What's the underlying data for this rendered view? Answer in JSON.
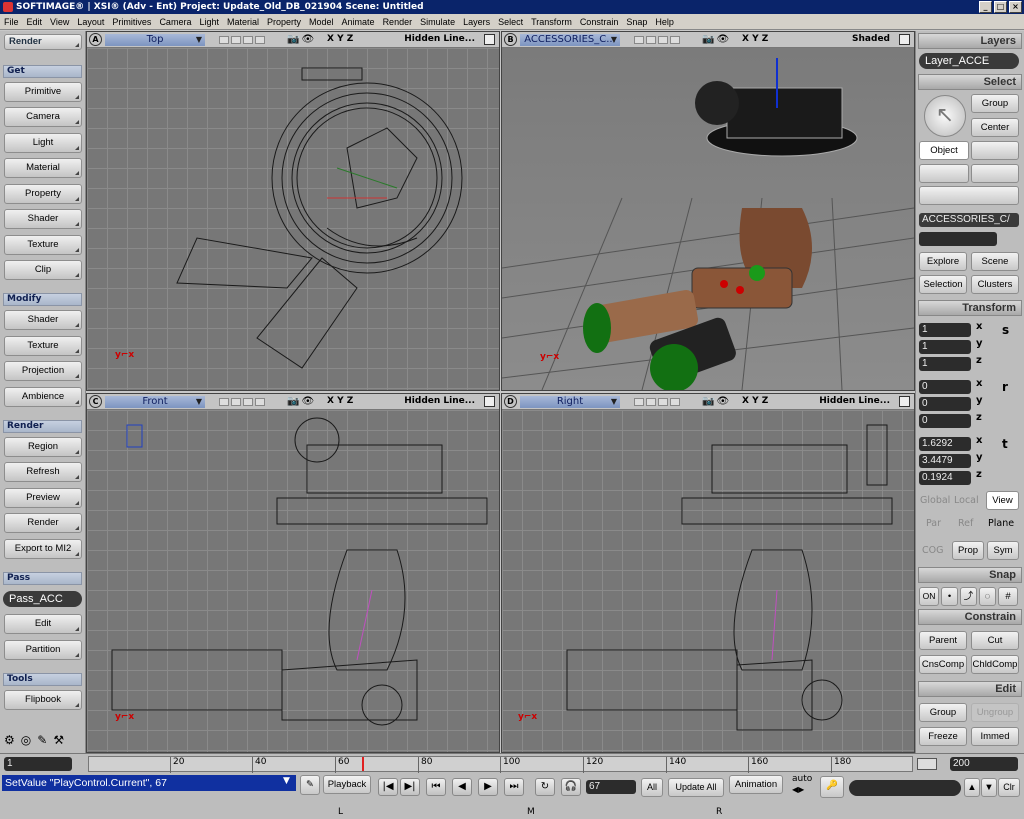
{
  "titlebar": {
    "title": "SOFTIMAGE® | XSI® (Adv - Ent) Project: Update_Old_DB_021904    Scene: Untitled",
    "min": "_",
    "max": "□",
    "close": "×"
  },
  "menu": [
    "File",
    "Edit",
    "View",
    "Layout",
    "Primitives",
    "Camera",
    "Light",
    "Material",
    "Property",
    "Model",
    "Animate",
    "Render",
    "Simulate",
    "Layers",
    "Select",
    "Transform",
    "Constrain",
    "Snap",
    "Help"
  ],
  "left": {
    "header": "Render",
    "get": {
      "title": "Get",
      "items": [
        "Primitive",
        "Camera",
        "Light",
        "Material",
        "Property",
        "Shader",
        "Texture",
        "Clip"
      ]
    },
    "modify": {
      "title": "Modify",
      "items": [
        "Shader",
        "Texture",
        "Projection",
        "Ambience"
      ]
    },
    "render": {
      "title": "Render",
      "items": [
        "Region",
        "Refresh",
        "Preview",
        "Render",
        "Export to MI2"
      ]
    },
    "pass": {
      "title": "Pass",
      "current": "Pass_ACC",
      "items": [
        "Edit",
        "Partition"
      ]
    },
    "tools": {
      "title": "Tools",
      "items": [
        "Flipbook"
      ]
    }
  },
  "viewports": [
    {
      "letter": "A",
      "name": "Top",
      "mode": "Hidden Line...",
      "axes": "X Y Z"
    },
    {
      "letter": "B",
      "name": "ACCESSORIES_C...",
      "mode": "Shaded",
      "axes": "X Y Z"
    },
    {
      "letter": "C",
      "name": "Front",
      "mode": "Hidden Line...",
      "axes": "X Y Z"
    },
    {
      "letter": "D",
      "name": "Right",
      "mode": "Hidden Line...",
      "axes": "X Y Z"
    }
  ],
  "right": {
    "layers": {
      "title": "Layers",
      "current": "Layer_ACCE"
    },
    "select": {
      "title": "Select",
      "group": "Group",
      "center": "Center",
      "object": "Object",
      "field": "ACCESSORIES_C/",
      "explore": "Explore",
      "scene": "Scene",
      "selection": "Selection",
      "clusters": "Clusters"
    },
    "transform": {
      "title": "Transform",
      "scale": [
        "1",
        "1",
        "1"
      ],
      "rotate": [
        "0",
        "0",
        "0"
      ],
      "translate": [
        "1.6292",
        "3.4479",
        "0.1924"
      ],
      "axis_labels": [
        "x",
        "y",
        "z"
      ],
      "global": "Global",
      "local": "Local",
      "view": "View",
      "par": "Par",
      "ref": "Ref",
      "plane": "Plane",
      "cog": "COG",
      "prop": "Prop",
      "sym": "Sym"
    },
    "snap": {
      "title": "Snap",
      "on": "ON"
    },
    "constrain": {
      "title": "Constrain",
      "parent": "Parent",
      "cut": "Cut",
      "cnscomp": "CnsComp",
      "chldcomp": "ChldComp"
    },
    "edit": {
      "title": "Edit",
      "group": "Group",
      "ungroup": "Ungroup",
      "freeze": "Freeze",
      "immed": "Immed"
    }
  },
  "timeline": {
    "start": "1",
    "end": "200",
    "ticks": [
      "20",
      "40",
      "60",
      "80",
      "100",
      "120",
      "140",
      "160",
      "180"
    ],
    "current_frame": 67
  },
  "bottom": {
    "command": "SetValue \"PlayControl.Current\", 67",
    "playback": "Playback",
    "frame": "67",
    "all": "All",
    "update_all": "Update All",
    "animation": "Animation",
    "auto": "auto",
    "clr": "Clr",
    "mouse": [
      "L",
      "M",
      "R"
    ]
  },
  "colors": {
    "title_bg": "#0a246a",
    "selection_blue": "#a8b8d8",
    "playhead": "#e02020"
  }
}
